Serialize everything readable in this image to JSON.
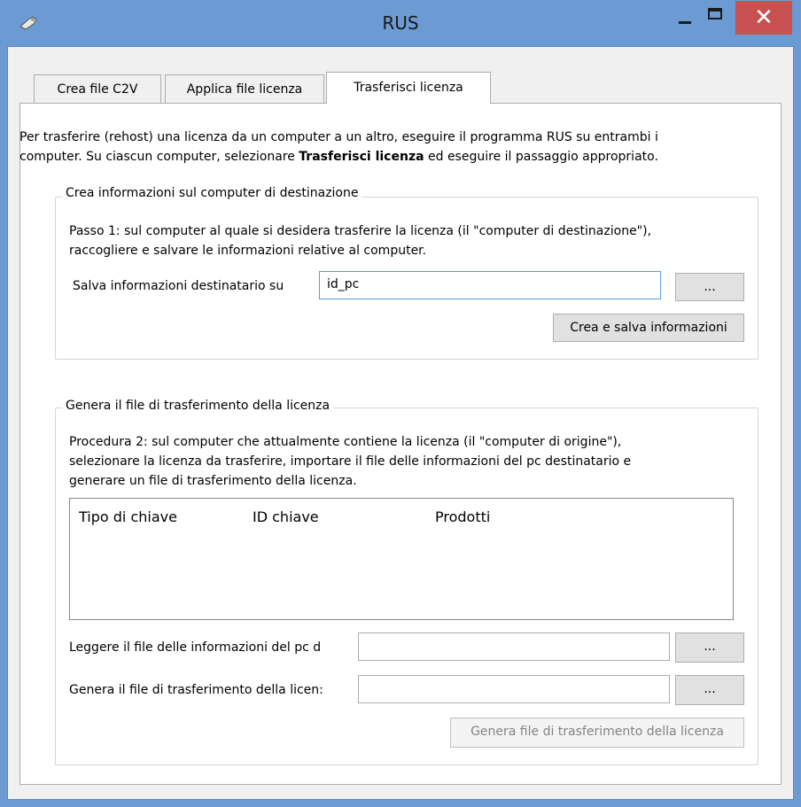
{
  "window": {
    "title": "RUS",
    "close_glyph": "✕",
    "colors": {
      "titlebar": "#6b9bd2",
      "close": "#c75050"
    }
  },
  "tabs": [
    {
      "label": "Crea file C2V"
    },
    {
      "label": "Applica file licenza"
    },
    {
      "label": "Trasferisci licenza"
    }
  ],
  "intro": {
    "line1": "Per trasferire (rehost) una licenza da un computer a un altro, eseguire il programma RUS su entrambi i",
    "line2_before": "computer. Su ciascun computer, selezionare ",
    "line2_bold": "Trasferisci licenza",
    "line2_after": " ed eseguire il passaggio appropriato."
  },
  "group1": {
    "legend": "Crea informazioni sul computer di destinazione",
    "desc_line1": "Passo 1: sul computer al quale si desidera trasferire la licenza (il \"computer di destinazione\"),",
    "desc_line2": "raccogliere e salvare le informazioni relative al computer.",
    "save_label": "Salva informazioni destinatario su",
    "save_value": "id_pc",
    "browse_label": "...",
    "create_button": "Crea e salva informazioni"
  },
  "group2": {
    "legend": "Genera il file di trasferimento della licenza",
    "desc_line1": "Procedura 2: sul computer che attualmente contiene la licenza (il \"computer di origine\"),",
    "desc_line2": "selezionare la licenza da trasferire, importare il file delle informazioni del pc destinatario e",
    "desc_line3": "generare un file di trasferimento della licenza.",
    "columns": [
      "Tipo di chiave",
      "ID chiave",
      "Prodotti"
    ],
    "read_label": "Leggere il file delle informazioni del pc d",
    "read_value": "",
    "gen_label": "Genera il file di trasferimento della licen:",
    "gen_value": "",
    "browse_label": "...",
    "generate_button": "Genera file di trasferimento della licenza"
  }
}
